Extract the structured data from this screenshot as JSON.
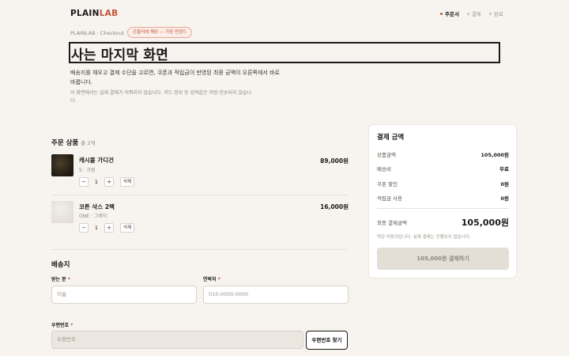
{
  "header": {
    "logo_main": "PLAIN",
    "logo_accent": "LAB",
    "steps": [
      "주문서",
      "결제",
      "완료"
    ]
  },
  "breadcrumb": "PLAINLAB · Checkout",
  "badge": "은둘러에 해당 — 가장 먼렌드",
  "title": "사는 마지막 화면",
  "description": "배송지를 채우고 결제 수단을 고르면, 쿠폰과 적립금이 반영된 최종 금액이 오른쪽에서 바로 바뀝니다.",
  "note": "이 화면에서는 실제 결제가 이뤄지지 않습니다. 카드 정보 등 입력값은 저장·전송되지 않습니다.",
  "order": {
    "title": "주문 상품",
    "count": "총 2개",
    "items": [
      {
        "name": "캐시볼 가디건",
        "option": "S · 크림",
        "qty": "1",
        "price": "89,000원",
        "delete": "삭제"
      },
      {
        "name": "코튼 삭스 2팩",
        "option": "ONE · 그레이",
        "qty": "1",
        "price": "16,000원",
        "delete": "삭제"
      }
    ]
  },
  "shipping": {
    "title": "배송지",
    "recipient_label": "받는 분",
    "recipient_placeholder": "이름",
    "phone_label": "연락처",
    "phone_placeholder": "010-0000-0000",
    "zip_label": "우편번호",
    "zip_placeholder": "우편번호",
    "zip_button": "우편번호 찾기",
    "required_mark": "*"
  },
  "summary": {
    "title": "결제 금액",
    "rows": [
      {
        "label": "상품금액",
        "value": "105,000원"
      },
      {
        "label": "배송비",
        "value": "무료"
      },
      {
        "label": "쿠폰 할인",
        "value": "0원"
      },
      {
        "label": "적립금 사용",
        "value": "0원"
      }
    ],
    "total_label": "최종 결제금액",
    "total_value": "105,000원",
    "helper": "약관 미동의입니다. 실제 결제는 진행되지 않습니다.",
    "pay_button": "105,000원 결제하기"
  },
  "colors": {
    "accent": "#c0563a",
    "background": "#f7f4ef",
    "disabled_button": "#e3dfd6"
  }
}
